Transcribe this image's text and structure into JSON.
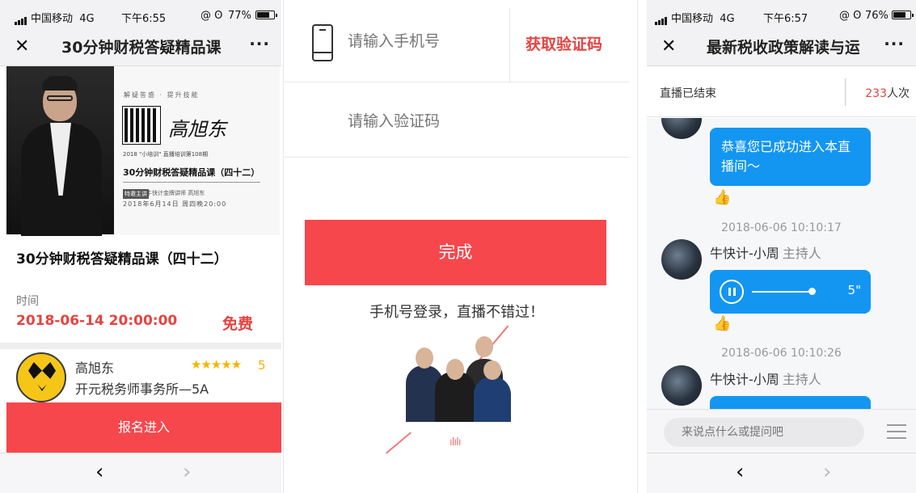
{
  "panel1": {
    "status": {
      "carrier": "中国移动",
      "network": "4G",
      "time": "下午6:55",
      "icons": "@ ʘ",
      "battery": "77%",
      "battery_level": 0.77
    },
    "title": "30分钟财税答疑精品课",
    "poster": {
      "motto": "解疑答惑 · 提升技能",
      "signature": "高旭东",
      "series": "2018 \"小培训\" 直播培训第108期",
      "title": "30分钟财税答疑精品课（四十二）",
      "tag": "特邀主讲",
      "lecturer": "牛快计金牌讲师 高旭东",
      "date": "2018年6月14日 周四晚20:00"
    },
    "course_title": "30分钟财税答疑精品课（四十二）",
    "time_label": "时间",
    "time_value": "2018-06-14 20:00:00",
    "price": "免费",
    "lecturer_name": "高旭东",
    "stars": "★★★★★",
    "rating": "5",
    "org": "开元税务师事务所—5A",
    "enroll_button": "报名进入",
    "nav": {
      "back": "‹",
      "forward": "›"
    }
  },
  "panel2": {
    "phone_placeholder": "请输入手机号",
    "get_code": "获取验证码",
    "code_placeholder": "请输入验证码",
    "done_button": "完成",
    "slogan": "手机号登录，直播不错过！",
    "wave": "ıIıIı"
  },
  "panel3": {
    "status": {
      "carrier": "中国移动",
      "network": "4G",
      "time": "下午6:57",
      "icons": "@ ʘ",
      "battery": "76%",
      "battery_level": 0.76
    },
    "title": "最新税收政策解读与运",
    "live_status": "直播已结束",
    "view_count": "233",
    "view_unit": "人次",
    "messages": {
      "welcome": "恭喜您已成功进入本直播间～",
      "ts1": "2018-06-06 10:10:17",
      "host_name": "牛快计-小周",
      "host_role": "主持人",
      "audio_duration": "5\"",
      "ts2": "2018-06-06 10:10:26"
    },
    "input_placeholder": "来说点什么或提问吧",
    "nav": {
      "back": "‹",
      "forward": "›"
    }
  },
  "common": {
    "close": "✕",
    "more": "···",
    "like": "👍"
  }
}
